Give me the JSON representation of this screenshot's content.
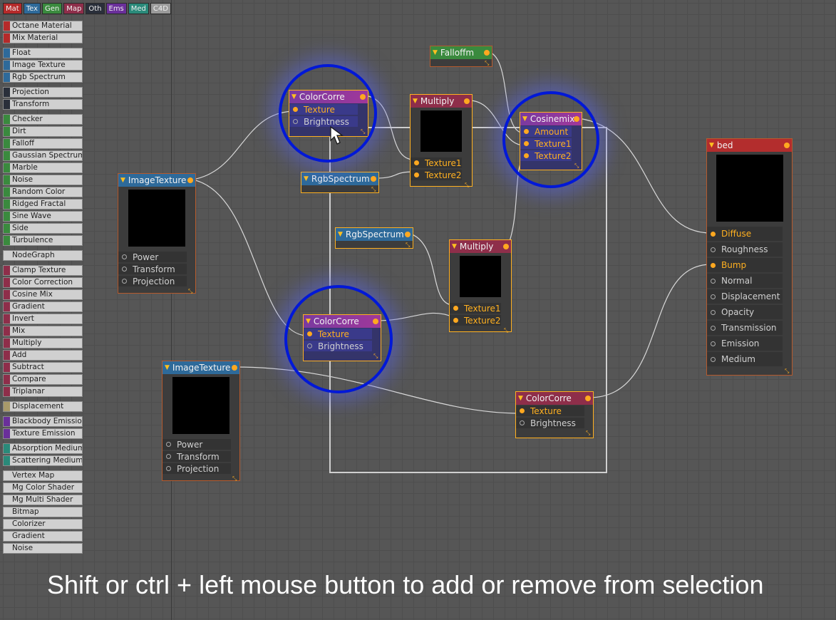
{
  "tabs": [
    {
      "label": "Mat",
      "color": "#b52a2a"
    },
    {
      "label": "Tex",
      "color": "#2e6a9a"
    },
    {
      "label": "Gen",
      "color": "#3a8a3e"
    },
    {
      "label": "Map",
      "color": "#8e2e4a"
    },
    {
      "label": "Oth",
      "color": "#2a2f3a"
    },
    {
      "label": "Ems",
      "color": "#6a2f9a"
    },
    {
      "label": "Med",
      "color": "#2a8a7a"
    },
    {
      "label": "C4D",
      "color": "#9a9a9a"
    }
  ],
  "palette": [
    {
      "label": "Octane Material",
      "color": "#b52a2a"
    },
    {
      "label": "Mix Material",
      "color": "#b52a2a"
    },
    {
      "label": "Float",
      "color": "#2e6a9a"
    },
    {
      "label": "Image Texture",
      "color": "#2e6a9a"
    },
    {
      "label": "Rgb Spectrum",
      "color": "#2e6a9a"
    },
    {
      "label": "Projection",
      "color": "#2a2f3a"
    },
    {
      "label": "Transform",
      "color": "#2a2f3a"
    },
    {
      "label": "Checker",
      "color": "#3a8a3e"
    },
    {
      "label": "Dirt",
      "color": "#3a8a3e"
    },
    {
      "label": "Falloff",
      "color": "#3a8a3e"
    },
    {
      "label": "Gaussian Spectrum",
      "color": "#3a8a3e"
    },
    {
      "label": "Marble",
      "color": "#3a8a3e"
    },
    {
      "label": "Noise",
      "color": "#3a8a3e"
    },
    {
      "label": "Random Color",
      "color": "#3a8a3e"
    },
    {
      "label": "Ridged Fractal",
      "color": "#3a8a3e"
    },
    {
      "label": "Sine Wave",
      "color": "#3a8a3e"
    },
    {
      "label": "Side",
      "color": "#3a8a3e"
    },
    {
      "label": "Turbulence",
      "color": "#3a8a3e"
    },
    {
      "label": "NodeGraph",
      "color": "#d0d0d0"
    },
    {
      "label": "Clamp Texture",
      "color": "#8e2e4a"
    },
    {
      "label": "Color Correction",
      "color": "#8e2e4a"
    },
    {
      "label": "Cosine Mix",
      "color": "#8e2e4a"
    },
    {
      "label": "Gradient",
      "color": "#8e2e4a"
    },
    {
      "label": "Invert",
      "color": "#8e2e4a"
    },
    {
      "label": "Mix",
      "color": "#8e2e4a"
    },
    {
      "label": "Multiply",
      "color": "#8e2e4a"
    },
    {
      "label": "Add",
      "color": "#8e2e4a"
    },
    {
      "label": "Subtract",
      "color": "#8e2e4a"
    },
    {
      "label": "Compare",
      "color": "#8e2e4a"
    },
    {
      "label": "Triplanar",
      "color": "#8e2e4a"
    },
    {
      "label": "Displacement",
      "color": "#a89a6a"
    },
    {
      "label": "Blackbody Emission",
      "color": "#6a2f9a"
    },
    {
      "label": "Texture Emission",
      "color": "#6a2f9a"
    },
    {
      "label": "Absorption Medium",
      "color": "#2a8a7a"
    },
    {
      "label": "Scattering Medium",
      "color": "#2a8a7a"
    },
    {
      "label": "Vertex Map",
      "color": "#d0d0d0"
    },
    {
      "label": "Mg Color Shader",
      "color": "#d0d0d0"
    },
    {
      "label": "Mg Multi Shader",
      "color": "#d0d0d0"
    },
    {
      "label": "Bitmap",
      "color": "#d0d0d0"
    },
    {
      "label": "Colorizer",
      "color": "#d0d0d0"
    },
    {
      "label": "Gradient",
      "color": "#d0d0d0"
    },
    {
      "label": "Noise",
      "color": "#d0d0d0"
    }
  ],
  "nodes": {
    "falloff": {
      "title": "Falloffm"
    },
    "colorcorrect1": {
      "title": "ColorCorre",
      "ports": [
        "Texture",
        "Brightness"
      ]
    },
    "multiply1": {
      "title": "Multiply",
      "ports": [
        "Texture1",
        "Texture2"
      ]
    },
    "cosinemix": {
      "title": "Cosinemix",
      "ports": [
        "Amount",
        "Texture1",
        "Texture2"
      ]
    },
    "imagetexture1": {
      "title": "ImageTexture",
      "ports": [
        "Power",
        "Transform",
        "Projection"
      ]
    },
    "rgbspectrum1": {
      "title": "RgbSpectrum"
    },
    "rgbspectrum2": {
      "title": "RgbSpectrum"
    },
    "multiply2": {
      "title": "Multiply",
      "ports": [
        "Texture1",
        "Texture2"
      ]
    },
    "colorcorrect2": {
      "title": "ColorCorre",
      "ports": [
        "Texture",
        "Brightness"
      ]
    },
    "imagetexture2": {
      "title": "ImageTexture",
      "ports": [
        "Power",
        "Transform",
        "Projection"
      ]
    },
    "colorcorrect3": {
      "title": "ColorCorre",
      "ports": [
        "Texture",
        "Brightness"
      ]
    },
    "bed": {
      "title": "bed",
      "ports": [
        "Diffuse",
        "Roughness",
        "Bump",
        "Normal",
        "Displacement",
        "Opacity",
        "Transmission",
        "Emission",
        "Medium"
      ]
    }
  },
  "caption": "Shift or ctrl + left mouse button to add or remove from selection"
}
